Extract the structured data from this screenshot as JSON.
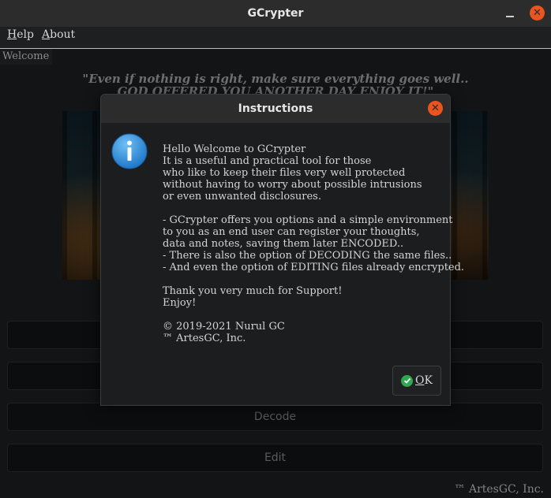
{
  "window": {
    "title": "GCrypter"
  },
  "menu": {
    "help": {
      "first": "H",
      "rest": "elp"
    },
    "about": {
      "first": "A",
      "rest": "bout"
    }
  },
  "tabs": [
    "Welcome"
  ],
  "main": {
    "quote_line1": "\"Even if nothing is right, make sure everything goes well..",
    "quote_line2": "GOD OFFERED YOU ANOTHER DAY ENJOY IT!\"",
    "buttons": [
      "",
      "",
      "Decode",
      "Edit"
    ],
    "footer": "™ ArtesGC, Inc."
  },
  "dialog": {
    "title": "Instructions",
    "icon": "info-icon",
    "lines": [
      "Hello Welcome to GCrypter",
      "It is a useful and practical tool for those",
      "who like to keep their files very well protected",
      "without having to worry about possible intrusions",
      "or even unwanted disclosures.",
      "",
      "- GCrypter offers you options and a simple environment",
      "to you as an end user can register your thoughts,",
      "data and notes, saving them later ENCODED..",
      "- There is also the option of DECODING the same files..",
      "- And even the option of EDITING files already encrypted.",
      "",
      "Thank you very much for Support!",
      "Enjoy!",
      "",
      "© 2019-2021 Nurul GC",
      "™ ArtesGC, Inc."
    ],
    "ok": {
      "first": "O",
      "rest": "K"
    }
  },
  "colors": {
    "accent_close": "#e9541f",
    "ok_check": "#2fa84f",
    "info_blue": "#2a8bd8"
  }
}
